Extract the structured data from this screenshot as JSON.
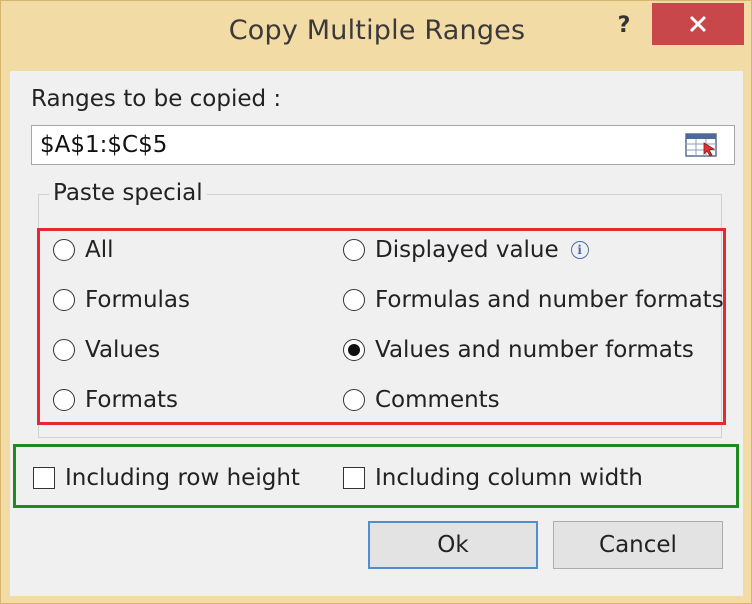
{
  "window": {
    "title": "Copy Multiple Ranges",
    "help_label": "?",
    "close_label": "X"
  },
  "ranges": {
    "label": "Ranges to be copied :",
    "value": "$A$1:$C$5"
  },
  "paste_special": {
    "group_label": "Paste special",
    "options": [
      {
        "label": "All",
        "selected": false
      },
      {
        "label": "Displayed value",
        "selected": false
      },
      {
        "label": "Formulas",
        "selected": false
      },
      {
        "label": "Formulas and number formats",
        "selected": false
      },
      {
        "label": "Values",
        "selected": false
      },
      {
        "label": "Values and number formats",
        "selected": true
      },
      {
        "label": "Formats",
        "selected": false
      },
      {
        "label": "Comments",
        "selected": false
      }
    ]
  },
  "checkboxes": {
    "row_height": {
      "label": "Including row height",
      "checked": false
    },
    "column_width": {
      "label": "Including column width",
      "checked": false
    }
  },
  "buttons": {
    "ok": "Ok",
    "cancel": "Cancel"
  },
  "colors": {
    "highlight_red": "#e32b2f",
    "highlight_green": "#1f8a1f",
    "close_red": "#c8474a"
  },
  "icons": {
    "info": "info-icon",
    "range_picker": "range-picker-icon"
  }
}
